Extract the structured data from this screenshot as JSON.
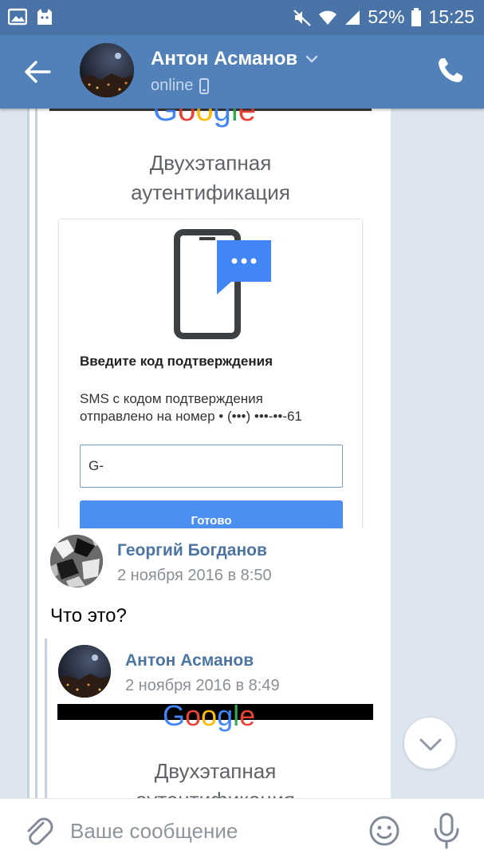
{
  "status_bar": {
    "battery_percent": "52%",
    "time": "15:25",
    "icons": [
      "image-icon",
      "cat-icon",
      "mute-icon",
      "wifi-icon",
      "signal-icon",
      "battery-icon"
    ]
  },
  "header": {
    "contact_name": "Антон Асманов",
    "status": "online",
    "icons": [
      "back-arrow-icon",
      "chevron-down-icon",
      "mobile-icon",
      "phone-icon"
    ]
  },
  "screenshot_1": {
    "logo_text": "Google",
    "title_line1": "Двухэтапная",
    "title_line2": "аутентификация",
    "heading": "Введите код подтверждения",
    "sms_line1": "SMS с кодом подтверждения",
    "sms_line2": "отправлено на номер • (•••) •••-••-61",
    "code_value": "G-",
    "done_label": "Готово"
  },
  "post": {
    "author": "Георгий Богданов",
    "date": "2 ноября 2016 в 8:50",
    "text": "Что это?"
  },
  "quoted_post": {
    "author": "Антон Асманов",
    "date": "2 ноября 2016 в 8:49",
    "logo_text": "Google",
    "title_line1": "Двухэтапная",
    "title_line2": "аутентификация"
  },
  "input_bar": {
    "placeholder": "Ваше сообщение",
    "icons": [
      "paperclip-icon",
      "emoji-icon",
      "microphone-icon"
    ]
  },
  "colors": {
    "status_bar": "#4a74a8",
    "header": "#5181b8",
    "background": "#dde6f0",
    "author_link": "#4d75a3",
    "google_button": "#4b8ff0",
    "google_blue": "#4285f4",
    "google_red": "#ea4335",
    "google_yellow": "#fbbc05",
    "google_green": "#34a853"
  }
}
